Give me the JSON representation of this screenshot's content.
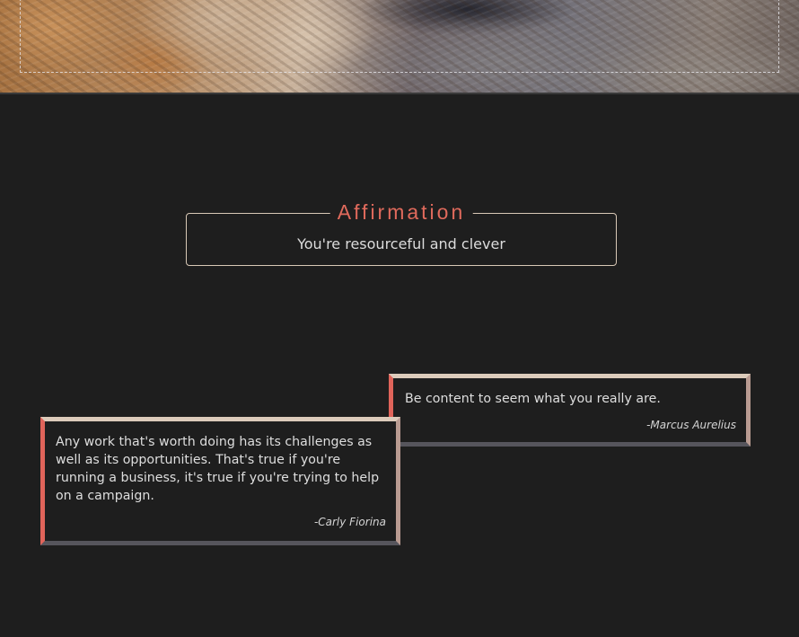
{
  "affirmation": {
    "title": "Affirmation",
    "text": "You're resourceful and clever"
  },
  "quotes": [
    {
      "text": "Be content to seem what you really are.",
      "author": "-Marcus Aurelius"
    },
    {
      "text": "Any work that's worth doing has its challenges as well as its opportunities. That's true if you're running a business, it's true if you're trying to help on a campaign.",
      "author": "-Carly Fiorina"
    }
  ],
  "colors": {
    "background": "#1e1e1e",
    "accent": "#e06a5c",
    "border_light": "#d8c8b6",
    "border_dark": "#56555c"
  }
}
